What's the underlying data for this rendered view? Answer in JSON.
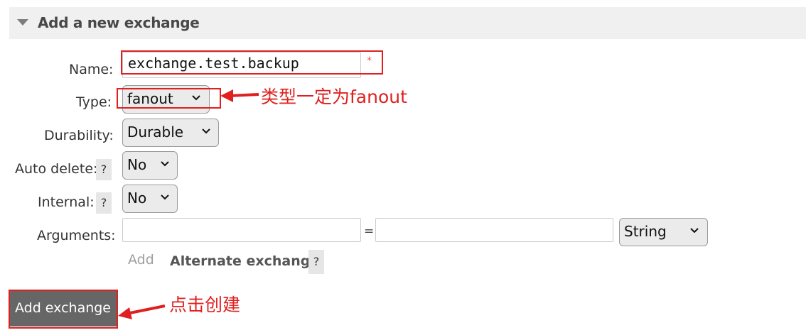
{
  "section": {
    "title": "Add a new exchange"
  },
  "form": {
    "name_label": "Name:",
    "name_value": "exchange.test.backup",
    "required_marker": "*",
    "type_label": "Type:",
    "type_value": "fanout",
    "durability_label": "Durability:",
    "durability_value": "Durable",
    "auto_delete_label": "Auto delete:",
    "auto_delete_value": "No",
    "internal_label": "Internal:",
    "internal_value": "No",
    "arguments_label": "Arguments:",
    "arguments_equals": "=",
    "arguments_type_value": "String",
    "help_symbol": "?",
    "add_link": "Add",
    "alternate_exchange": "Alternate exchange",
    "submit_label": "Add exchange"
  },
  "annotations": {
    "type_note": "类型一定为fanout",
    "submit_note": "点击创建",
    "color": "#e02020"
  }
}
